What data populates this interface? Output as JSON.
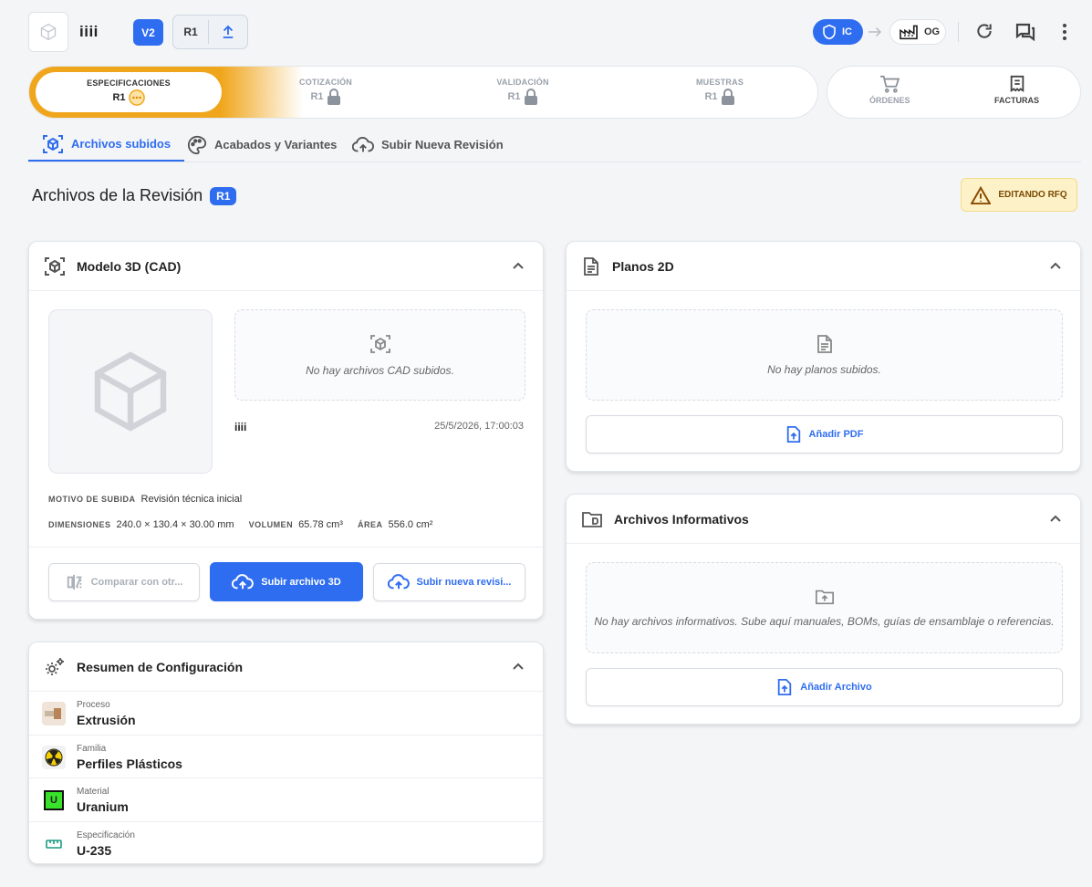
{
  "header": {
    "project_name": "iiii",
    "version": "V2",
    "revision": "R1",
    "ic_label": "IC",
    "og_label": "OG"
  },
  "stages": [
    {
      "label": "ESPECIFICACIONES",
      "rev": "R1",
      "state": "active"
    },
    {
      "label": "COTIZACIÓN",
      "rev": "R1",
      "state": "locked"
    },
    {
      "label": "VALIDACIÓN",
      "rev": "R1",
      "state": "locked"
    },
    {
      "label": "MUESTRAS",
      "rev": "R1",
      "state": "locked"
    }
  ],
  "orders": [
    {
      "label": "ÓRDENES"
    },
    {
      "label": "FACTURAS"
    }
  ],
  "tabs": [
    {
      "label": "Archivos subidos"
    },
    {
      "label": "Acabados y Variantes"
    },
    {
      "label": "Subir Nueva Revisión"
    }
  ],
  "page": {
    "title": "Archivos de la Revisión",
    "rev_badge": "R1",
    "edit_badge": "EDITANDO RFQ"
  },
  "cad": {
    "title": "Modelo 3D (CAD)",
    "empty": "No hay archivos CAD subidos.",
    "file_name": "iiii",
    "timestamp": "25/5/2026, 17:00:03",
    "motivo_label": "MOTIVO DE SUBIDA",
    "motivo_val": "Revisión técnica inicial",
    "dim_label": "DIMENSIONES",
    "dim_val": "240.0 × 130.4 × 30.00 mm",
    "vol_label": "VOLUMEN",
    "vol_val": "65.78 cm³",
    "area_label": "ÁREA",
    "area_val": "556.0 cm²",
    "btn_compare": "Comparar con otr...",
    "btn_upload": "Subir archivo 3D",
    "btn_new_rev": "Subir nueva revisi..."
  },
  "config": {
    "title": "Resumen de Configuración",
    "rows": [
      {
        "label": "Proceso",
        "value": "Extrusión"
      },
      {
        "label": "Familia",
        "value": "Perfiles Plásticos"
      },
      {
        "label": "Material",
        "value": "Uranium",
        "icon_text": "U"
      },
      {
        "label": "Especificación",
        "value": "U-235"
      }
    ]
  },
  "planos": {
    "title": "Planos 2D",
    "empty": "No hay planos subidos.",
    "btn": "Añadir PDF"
  },
  "info": {
    "title": "Archivos Informativos",
    "empty": "No hay archivos informativos. Sube aquí manuales, BOMs, guías de ensamblaje o referencias.",
    "btn": "Añadir Archivo"
  },
  "colors": {
    "accent": "#2f6df0",
    "stage_active": "#f0a61c",
    "warning_bg": "#fdf1c8"
  }
}
